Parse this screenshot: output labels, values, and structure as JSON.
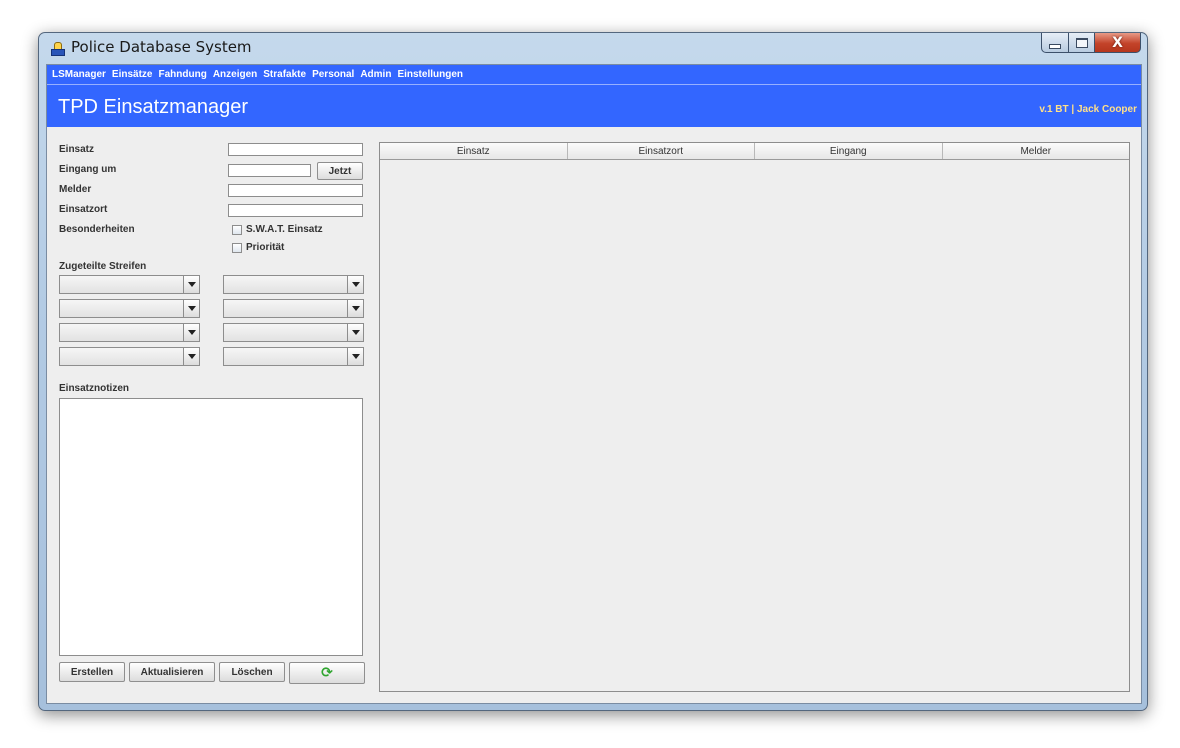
{
  "window": {
    "title": "Police Database System"
  },
  "menu": [
    "LSManager",
    "Einsätze",
    "Fahndung",
    "Anzeigen",
    "Strafakte",
    "Personal",
    "Admin",
    "Einstellungen"
  ],
  "header": {
    "title": "TPD Einsatzmanager",
    "user_info": "v.1 BT | Jack Cooper"
  },
  "form": {
    "einsatz": {
      "label": "Einsatz",
      "value": ""
    },
    "eingang": {
      "label": "Eingang um",
      "value": "",
      "now_button": "Jetzt"
    },
    "melder": {
      "label": "Melder",
      "value": ""
    },
    "einsatzort": {
      "label": "Einsatzort",
      "value": ""
    },
    "besonderheiten": {
      "label": "Besonderheiten",
      "swat": {
        "label": "S.W.A.T. Einsatz",
        "checked": false
      },
      "prioritaet": {
        "label": "Priorität",
        "checked": false
      }
    },
    "streifen": {
      "label": "Zugeteilte Streifen",
      "selected": [
        "",
        "",
        "",
        "",
        "",
        "",
        "",
        ""
      ]
    },
    "notizen": {
      "label": "Einsatznotizen",
      "value": ""
    }
  },
  "buttons": {
    "create": "Erstellen",
    "update": "Aktualisieren",
    "delete": "Löschen",
    "refresh_icon": "refresh-icon"
  },
  "table": {
    "columns": [
      "Einsatz",
      "Einsatzort",
      "Eingang",
      "Melder"
    ],
    "rows": []
  },
  "colors": {
    "accent": "#3366ff",
    "background": "#eeeeee",
    "user_info": "#ffe08a"
  }
}
